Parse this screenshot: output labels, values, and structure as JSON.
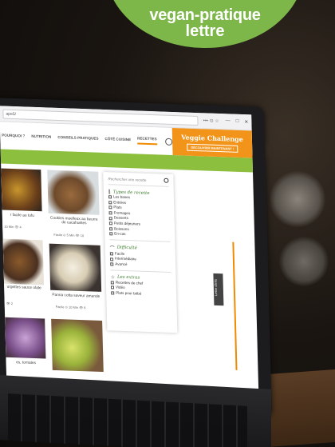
{
  "headline": {
    "line1": "vegan-pratique",
    "line2": "lettre"
  },
  "browser": {
    "url": "ape5/",
    "tools": "••• ⊙ ☆",
    "win_buttons": [
      "—",
      "□",
      "✕"
    ]
  },
  "nav": {
    "items": [
      "POURQUOI ?",
      "NUTRITION",
      "CONSEILS PRATIQUES",
      "CÔTÉ CUISINE",
      "RECETTES"
    ],
    "active": "RECETTES",
    "banner_title": "Veggie Challenge",
    "banner_cta": "DÉCOUVRIR MAINTENANT !"
  },
  "cards": [
    {
      "caption": "r facile au tofu",
      "meta": "10 Min  👁 4"
    },
    {
      "caption": "Cookies moelleux au beurre de cacahuètes",
      "meta": "Facile  ⊙ 5 Min  👁 10"
    },
    {
      "caption": "urgettes sauce olate",
      "meta": "👁 2"
    },
    {
      "caption": "Panna cotta saveur amande",
      "meta": "Facile  ⊙ 10 Min  👁 8"
    },
    {
      "caption": "es, tomates",
      "meta": ""
    }
  ],
  "filters": {
    "search_placeholder": "Rechercher une recette",
    "types_title": "Types de recette",
    "types": [
      "Les bases",
      "Entrées",
      "Plats",
      "Fromages",
      "Desserts",
      "Petits déjeuners",
      "Boissons",
      "En-cas"
    ],
    "difficulty_title": "Difficulté",
    "difficulty": [
      "Facile",
      "Intermédiaire",
      "Avancé"
    ],
    "extras_title": "Les extras",
    "extras": [
      "Recettes de chef",
      "Vidéo",
      "Plats pour bébé"
    ]
  },
  "side_tab": "Lettre d'info",
  "colors": {
    "green": "#7db749",
    "orange": "#f18a00",
    "bar_green": "#8dbf3f"
  }
}
